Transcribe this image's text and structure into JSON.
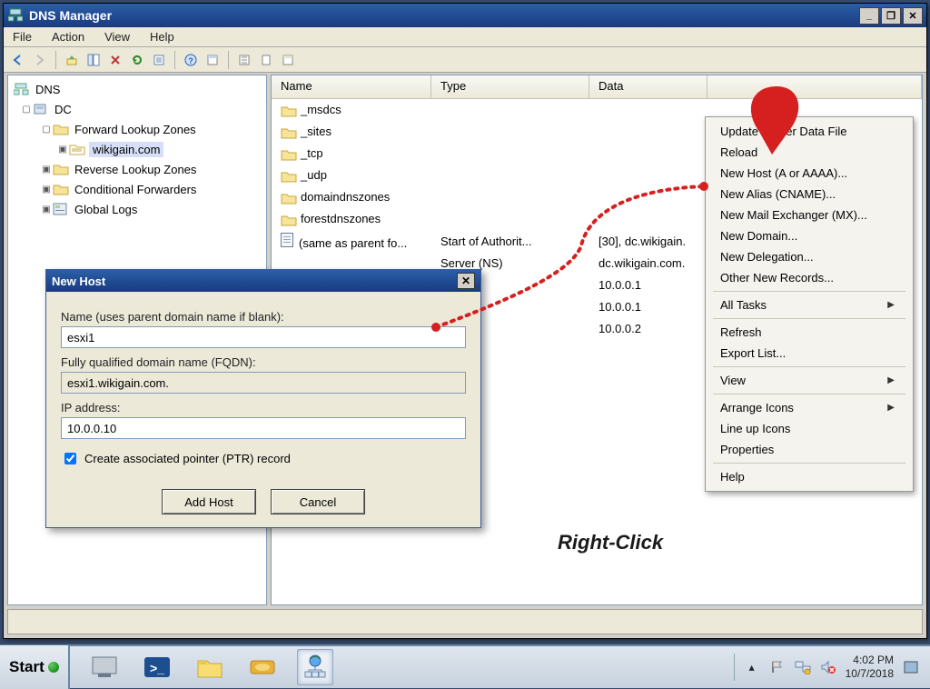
{
  "window": {
    "title": "DNS Manager"
  },
  "menubar": {
    "file": "File",
    "action": "Action",
    "view": "View",
    "help": "Help"
  },
  "tree": {
    "root": "DNS",
    "dc": "DC",
    "fwd": "Forward Lookup Zones",
    "zone": "wikigain.com",
    "rev": "Reverse Lookup Zones",
    "cond": "Conditional Forwarders",
    "logs": "Global Logs"
  },
  "columns": {
    "name": "Name",
    "type": "Type",
    "data": "Data"
  },
  "rows": [
    {
      "name": "_msdcs",
      "type": "",
      "data": ""
    },
    {
      "name": "_sites",
      "type": "",
      "data": ""
    },
    {
      "name": "_tcp",
      "type": "",
      "data": ""
    },
    {
      "name": "_udp",
      "type": "",
      "data": ""
    },
    {
      "name": "domaindnszones",
      "type": "",
      "data": ""
    },
    {
      "name": "forestdnszones",
      "type": "",
      "data": ""
    },
    {
      "name": "(same as parent fo...",
      "type": "Start of Authorit...",
      "data": "[30], dc.wikigain."
    },
    {
      "name": "",
      "type": "Server (NS)",
      "data": "dc.wikigain.com."
    },
    {
      "name": "",
      "type": "A)",
      "data": "10.0.0.1"
    },
    {
      "name": "",
      "type": "A)",
      "data": "10.0.0.1"
    },
    {
      "name": "",
      "type": "A)",
      "data": "10.0.0.2"
    }
  ],
  "context_menu": {
    "items1": [
      "Update Server Data File",
      "Reload",
      "New Host (A or AAAA)...",
      "New Alias (CNAME)...",
      "New Mail Exchanger (MX)...",
      "New Domain...",
      "New Delegation...",
      "Other New Records..."
    ],
    "all_tasks": "All Tasks",
    "refresh": "Refresh",
    "export": "Export List...",
    "view": "View",
    "arrange": "Arrange Icons",
    "lineup": "Line up Icons",
    "props": "Properties",
    "help": "Help"
  },
  "dialog": {
    "title": "New Host",
    "name_label": "Name (uses parent domain name if blank):",
    "name_value": "esxi1",
    "fqdn_label": "Fully qualified domain name (FQDN):",
    "fqdn_value": "esxi1.wikigain.com.",
    "ip_label": "IP address:",
    "ip_value": "10.0.0.10",
    "ptr_label": "Create associated pointer (PTR) record",
    "add": "Add Host",
    "cancel": "Cancel"
  },
  "annotation": {
    "label": "Right-Click"
  },
  "taskbar": {
    "start": "Start",
    "time": "4:02 PM",
    "date": "10/7/2018"
  }
}
